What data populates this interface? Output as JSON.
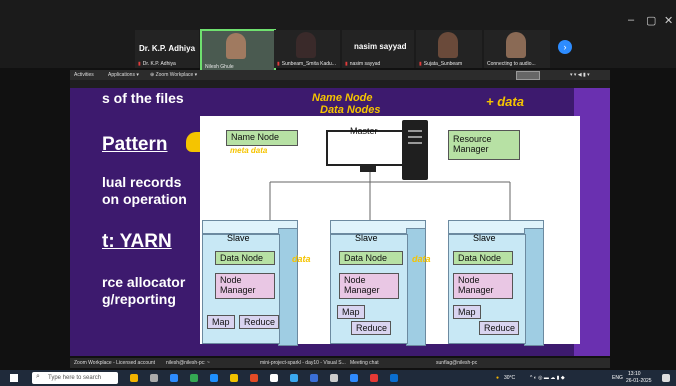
{
  "zoom": {
    "window_controls": {
      "minimize": "–",
      "restore": "▢",
      "close": "✕"
    },
    "participants": [
      {
        "name": "Dr. K.P. Adhiya",
        "caption": "Dr. K.P. Adhiya"
      },
      {
        "name": "",
        "caption": "Nilesh Ghule"
      },
      {
        "name": "",
        "caption": "Sunbeam_Smita Kadu..."
      },
      {
        "name": "nasim sayyad",
        "caption": "nasim sayyad"
      },
      {
        "name": "",
        "caption": "Sujata_Sunbeam"
      },
      {
        "name": "",
        "caption": "Connecting to audio..."
      }
    ]
  },
  "ubuntu": {
    "activities": "Activities",
    "applications": "Applications ▾",
    "zoom_menu": "⊕ Zoom Workplace ▾"
  },
  "slide": {
    "left_lines": [
      "s of the files",
      "Pattern",
      "lual records",
      "on operation",
      "t: YARN",
      "rce allocator",
      "g/reporting"
    ],
    "diagram": {
      "master": "Master",
      "name_node": "Name Node",
      "resource_manager": "Resource\nManager",
      "slave": "Slave",
      "data_node": "Data Node",
      "node_manager": "Node\nManager",
      "map": "Map",
      "reduce": "Reduce"
    },
    "annotations": {
      "top1": "Name Node",
      "top2": "Data Nodes",
      "plus_data": "+ data",
      "meta_data": "meta data",
      "data1": "data",
      "data2": "data"
    }
  },
  "linux_taskbar": {
    "items": [
      "Zoom Workplace - Licensed account",
      "nilesh@nilesh-pc: ~",
      "mini-project-sparkl - day10 - Visual S...",
      "Meeting chat",
      "sunflag@nilesh-pc"
    ]
  },
  "windows_taskbar": {
    "search_placeholder": "Type here to search",
    "weather": "30°C",
    "lang": "ENG",
    "time": "13:10",
    "date": "26-01-2025"
  }
}
